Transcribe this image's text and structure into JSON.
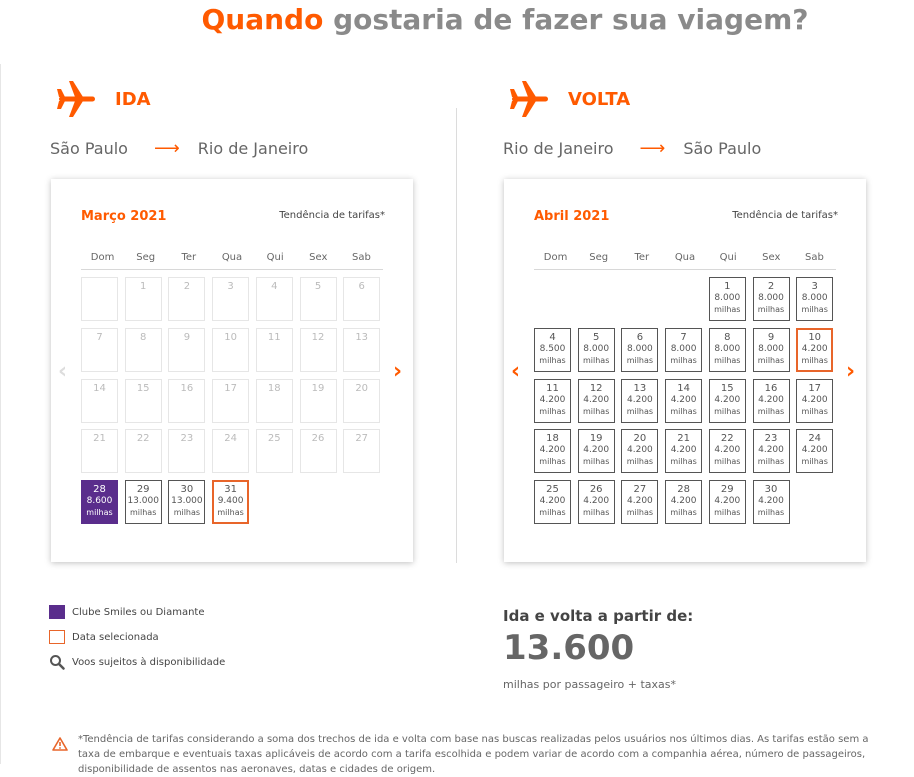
{
  "header": {
    "title_accent": "Quando",
    "title_rest": "gostaria de fazer sua viagem?"
  },
  "outbound": {
    "label": "IDA",
    "from": "São Paulo",
    "to": "Rio de Janeiro",
    "calendar": {
      "month": "Março 2021",
      "trend_label": "Tendência de tarifas*",
      "weekdays": [
        "Dom",
        "Seg",
        "Ter",
        "Qua",
        "Qui",
        "Sex",
        "Sab"
      ],
      "cells": [
        {
          "day": "",
          "state": "empty"
        },
        {
          "day": "1",
          "state": "disabled"
        },
        {
          "day": "2",
          "state": "disabled"
        },
        {
          "day": "3",
          "state": "disabled"
        },
        {
          "day": "4",
          "state": "disabled"
        },
        {
          "day": "5",
          "state": "disabled"
        },
        {
          "day": "6",
          "state": "disabled"
        },
        {
          "day": "7",
          "state": "disabled"
        },
        {
          "day": "8",
          "state": "disabled"
        },
        {
          "day": "9",
          "state": "disabled"
        },
        {
          "day": "10",
          "state": "disabled"
        },
        {
          "day": "11",
          "state": "disabled"
        },
        {
          "day": "12",
          "state": "disabled"
        },
        {
          "day": "13",
          "state": "disabled"
        },
        {
          "day": "14",
          "state": "disabled"
        },
        {
          "day": "15",
          "state": "disabled"
        },
        {
          "day": "16",
          "state": "disabled"
        },
        {
          "day": "17",
          "state": "disabled"
        },
        {
          "day": "18",
          "state": "disabled"
        },
        {
          "day": "19",
          "state": "disabled"
        },
        {
          "day": "20",
          "state": "disabled"
        },
        {
          "day": "21",
          "state": "disabled"
        },
        {
          "day": "22",
          "state": "disabled"
        },
        {
          "day": "23",
          "state": "disabled"
        },
        {
          "day": "24",
          "state": "disabled"
        },
        {
          "day": "25",
          "state": "disabled"
        },
        {
          "day": "26",
          "state": "disabled"
        },
        {
          "day": "27",
          "state": "disabled"
        },
        {
          "day": "28",
          "state": "club",
          "price": "8.600",
          "unit": "milhas"
        },
        {
          "day": "29",
          "state": "avail",
          "price": "13.000",
          "unit": "milhas"
        },
        {
          "day": "30",
          "state": "avail",
          "price": "13.000",
          "unit": "milhas"
        },
        {
          "day": "31",
          "state": "selected",
          "price": "9.400",
          "unit": "milhas"
        }
      ]
    }
  },
  "return": {
    "label": "VOLTA",
    "from": "Rio de Janeiro",
    "to": "São Paulo",
    "calendar": {
      "month": "Abril 2021",
      "trend_label": "Tendência de tarifas*",
      "weekdays": [
        "Dom",
        "Seg",
        "Ter",
        "Qua",
        "Qui",
        "Sex",
        "Sab"
      ],
      "cells": [
        {
          "day": "",
          "state": "none"
        },
        {
          "day": "",
          "state": "none"
        },
        {
          "day": "",
          "state": "none"
        },
        {
          "day": "",
          "state": "none"
        },
        {
          "day": "1",
          "state": "avail",
          "price": "8.000",
          "unit": "milhas"
        },
        {
          "day": "2",
          "state": "avail",
          "price": "8.000",
          "unit": "milhas"
        },
        {
          "day": "3",
          "state": "avail",
          "price": "8.000",
          "unit": "milhas"
        },
        {
          "day": "4",
          "state": "avail",
          "price": "8.500",
          "unit": "milhas"
        },
        {
          "day": "5",
          "state": "avail",
          "price": "8.000",
          "unit": "milhas"
        },
        {
          "day": "6",
          "state": "avail",
          "price": "8.000",
          "unit": "milhas"
        },
        {
          "day": "7",
          "state": "avail",
          "price": "8.000",
          "unit": "milhas"
        },
        {
          "day": "8",
          "state": "avail",
          "price": "8.000",
          "unit": "milhas"
        },
        {
          "day": "9",
          "state": "avail",
          "price": "8.000",
          "unit": "milhas"
        },
        {
          "day": "10",
          "state": "selected",
          "price": "4.200",
          "unit": "milhas"
        },
        {
          "day": "11",
          "state": "avail",
          "price": "4.200",
          "unit": "milhas"
        },
        {
          "day": "12",
          "state": "avail",
          "price": "4.200",
          "unit": "milhas"
        },
        {
          "day": "13",
          "state": "avail",
          "price": "4.200",
          "unit": "milhas"
        },
        {
          "day": "14",
          "state": "avail",
          "price": "4.200",
          "unit": "milhas"
        },
        {
          "day": "15",
          "state": "avail",
          "price": "4.200",
          "unit": "milhas"
        },
        {
          "day": "16",
          "state": "avail",
          "price": "4.200",
          "unit": "milhas"
        },
        {
          "day": "17",
          "state": "avail",
          "price": "4.200",
          "unit": "milhas"
        },
        {
          "day": "18",
          "state": "avail",
          "price": "4.200",
          "unit": "milhas"
        },
        {
          "day": "19",
          "state": "avail",
          "price": "4.200",
          "unit": "milhas"
        },
        {
          "day": "20",
          "state": "avail",
          "price": "4.200",
          "unit": "milhas"
        },
        {
          "day": "21",
          "state": "avail",
          "price": "4.200",
          "unit": "milhas"
        },
        {
          "day": "22",
          "state": "avail",
          "price": "4.200",
          "unit": "milhas"
        },
        {
          "day": "23",
          "state": "avail",
          "price": "4.200",
          "unit": "milhas"
        },
        {
          "day": "24",
          "state": "avail",
          "price": "4.200",
          "unit": "milhas"
        },
        {
          "day": "25",
          "state": "avail",
          "price": "4.200",
          "unit": "milhas"
        },
        {
          "day": "26",
          "state": "avail",
          "price": "4.200",
          "unit": "milhas"
        },
        {
          "day": "27",
          "state": "avail",
          "price": "4.200",
          "unit": "milhas"
        },
        {
          "day": "28",
          "state": "avail",
          "price": "4.200",
          "unit": "milhas"
        },
        {
          "day": "29",
          "state": "avail",
          "price": "4.200",
          "unit": "milhas"
        },
        {
          "day": "30",
          "state": "avail",
          "price": "4.200",
          "unit": "milhas"
        }
      ]
    }
  },
  "legend": {
    "club": "Clube Smiles ou Diamante",
    "selected": "Data selecionada",
    "availability": "Voos sujeitos à disponibilidade"
  },
  "summary": {
    "heading": "Ida e volta a partir de:",
    "value": "13.600",
    "sub": "milhas por passageiro + taxas*"
  },
  "disclaimer": "*Tendência de tarifas considerando a soma dos trechos de ida e volta com base nas buscas realizadas pelos usuários nos últimos dias. As tarifas estão sem a taxa de embarque e eventuais taxas aplicáveis de acordo com a tarifa escolhida e podem variar de acordo com a companhia aérea, número de passageiros, disponibilidade de assentos nas aeronaves, datas e cidades de origem.",
  "colors": {
    "accent": "#ff5a00",
    "club": "#5a2d8c",
    "selected_border": "#e8652a"
  },
  "icons": {
    "plane": "airplane-icon",
    "prev": "chevron-left-icon",
    "next": "chevron-right-icon",
    "search": "magnifier-icon",
    "warning": "warning-icon"
  }
}
